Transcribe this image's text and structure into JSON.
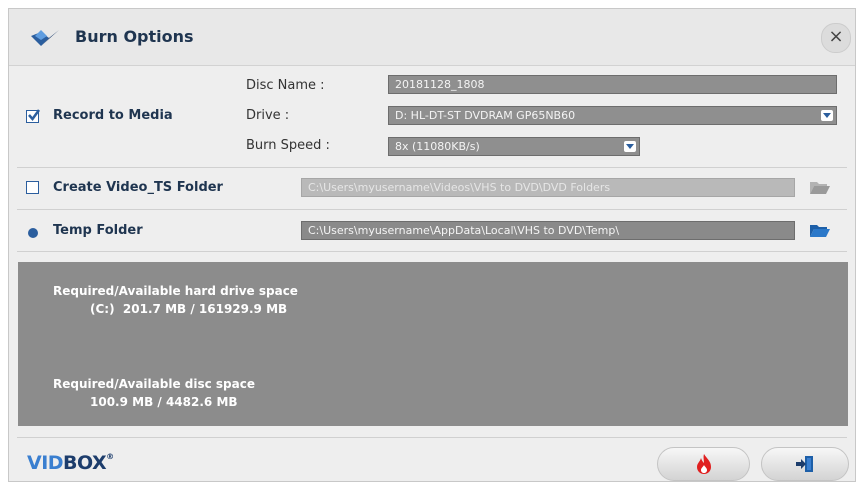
{
  "dialog": {
    "title": "Burn Options",
    "close_label": "×"
  },
  "record": {
    "label": "Record to Media",
    "checked": true,
    "disc_name_label": "Disc Name :",
    "disc_name_value": "20181128_1808",
    "drive_label": "Drive :",
    "drive_value": "D: HL-DT-ST DVDRAM GP65NB60",
    "speed_label": "Burn Speed :",
    "speed_value": "8x (11080KB/s)"
  },
  "video_ts": {
    "label": "Create Video_TS Folder",
    "checked": false,
    "path": "C:\\Users\\myusername\\Videos\\VHS to DVD\\DVD Folders"
  },
  "temp": {
    "label": "Temp Folder",
    "path": "C:\\Users\\myusername\\AppData\\Local\\VHS to DVD\\Temp\\"
  },
  "space": {
    "hdd_title": "Required/Available hard drive space",
    "hdd_value": "(C:)  201.7 MB / 161929.9 MB",
    "disc_title": "Required/Available disc space",
    "disc_value": "100.9 MB / 4482.6 MB"
  },
  "brand": {
    "vid": "VID",
    "box": "BOX",
    "reg": "®"
  },
  "icons": {
    "title": "vidbox-logo-icon",
    "folder": "folder-open-icon",
    "burn": "burn-flame-icon",
    "exit": "exit-door-icon"
  },
  "colors": {
    "accent": "#2b5e9e",
    "field": "#8f8f8f",
    "panel": "#8c8c8c",
    "burn": "#e02020"
  }
}
